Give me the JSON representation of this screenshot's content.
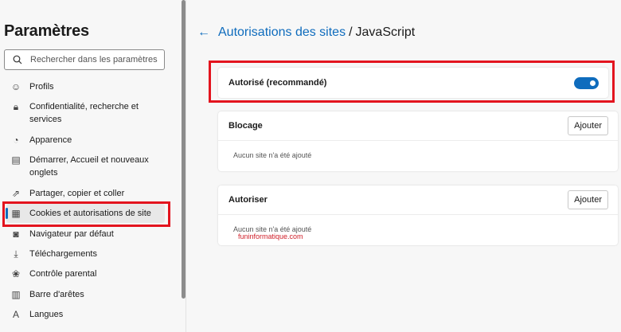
{
  "sidebar": {
    "title": "Paramètres",
    "search_placeholder": "Rechercher dans les paramètres",
    "items": [
      {
        "label": "Profils",
        "icon": "profile-icon"
      },
      {
        "label": "Confidentialité, recherche et services",
        "icon": "lock-icon"
      },
      {
        "label": "Apparence",
        "icon": "palette-icon"
      },
      {
        "label": "Démarrer, Accueil et nouveaux onglets",
        "icon": "home-tab-icon"
      },
      {
        "label": "Partager, copier et coller",
        "icon": "share-icon"
      },
      {
        "label": "Cookies et autorisations de site",
        "icon": "cookies-settings-icon",
        "active": true
      },
      {
        "label": "Navigateur par défaut",
        "icon": "default-browser-icon"
      },
      {
        "label": "Téléchargements",
        "icon": "download-icon"
      },
      {
        "label": "Contrôle parental",
        "icon": "family-icon"
      },
      {
        "label": "Barre d'arêtes",
        "icon": "sidebar-bar-icon"
      },
      {
        "label": "Langues",
        "icon": "language-icon"
      }
    ]
  },
  "main": {
    "breadcrumb_parent": "Autorisations des sites",
    "separator": "/",
    "title": "JavaScript",
    "allowed": {
      "label": "Autorisé (recommandé)",
      "enabled": true
    },
    "sections": [
      {
        "title": "Blocage",
        "button": "Ajouter",
        "empty": "Aucun site n'a été ajouté"
      },
      {
        "title": "Autoriser",
        "button": "Ajouter",
        "empty": "Aucun site n'a été ajouté"
      }
    ]
  },
  "watermark": "funinformatique.com",
  "colors": {
    "accent": "#0f6cbd",
    "highlight": "#e3141e"
  }
}
